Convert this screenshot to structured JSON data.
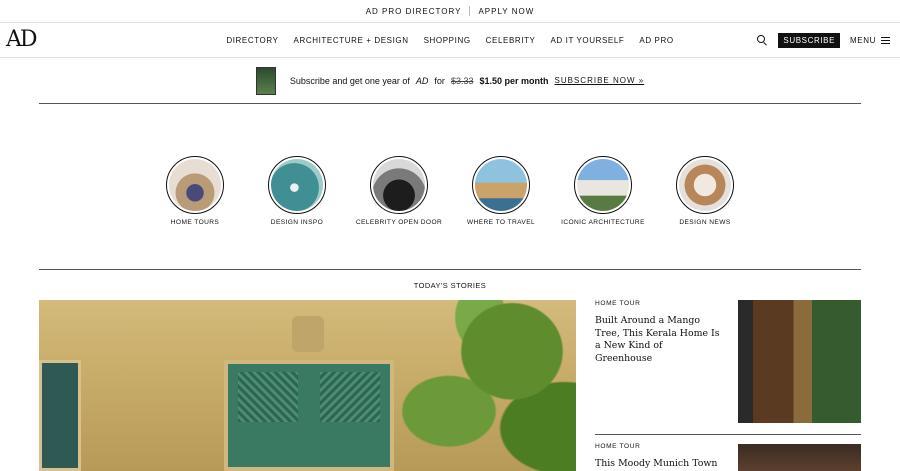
{
  "topbar": {
    "links": [
      "AD PRO DIRECTORY",
      "APPLY NOW"
    ]
  },
  "header": {
    "logo": "AD",
    "nav": [
      "DIRECTORY",
      "ARCHITECTURE + DESIGN",
      "SHOPPING",
      "CELEBRITY",
      "AD IT YOURSELF",
      "AD PRO"
    ],
    "subscribe": "SUBSCRIBE",
    "menu": "MENU"
  },
  "promo": {
    "text": "Subscribe and get one year of",
    "brand": "AD",
    "for": "for",
    "old_price": "$3.33",
    "new_price": "$1.50 per month",
    "link": "SUBSCRIBE NOW »"
  },
  "categories": [
    {
      "label": "HOME TOURS"
    },
    {
      "label": "DESIGN INSPO"
    },
    {
      "label": "CELEBRITY OPEN DOOR"
    },
    {
      "label": "WHERE TO TRAVEL"
    },
    {
      "label": "ICONIC ARCHITECTURE"
    },
    {
      "label": "DESIGN NEWS"
    }
  ],
  "section_title": "TODAY'S STORIES",
  "stories": [
    {
      "tag": "HOME TOUR",
      "title": "Built Around a Mango Tree, This Kerala Home Is a New Kind of Greenhouse"
    },
    {
      "tag": "HOME TOUR",
      "title": "This Moody Munich Town"
    }
  ]
}
